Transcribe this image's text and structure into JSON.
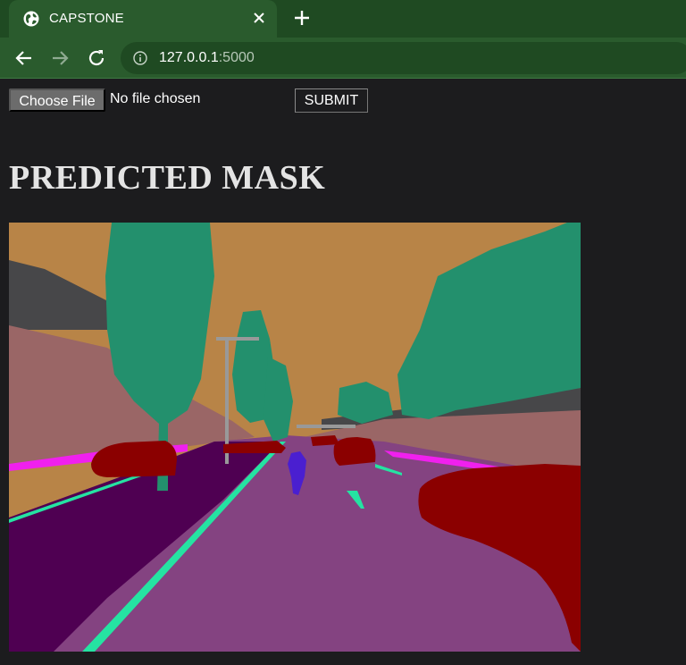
{
  "browser": {
    "tab_title": "CAPSTONE",
    "url_host": "127.0.0.1",
    "url_port": ":5000"
  },
  "form": {
    "file_button_label": "Choose File",
    "file_status": "No file chosen",
    "submit_label": "SUBMIT"
  },
  "page": {
    "heading": "PREDICTED MASK"
  },
  "mask_colors": {
    "sky": "#b88447",
    "vegetation": "#23906d",
    "building": "#474749",
    "wall": "#9a6666",
    "road": "#844381",
    "road_shadow": "#4f0052",
    "sidewalk": "#f020ee",
    "vehicle": "#8b0000",
    "lane_marking": "#25e3a2",
    "person": "#4a1fd0",
    "pole": "#999999"
  },
  "icons": {
    "favicon": "globe-icon",
    "close": "close-icon",
    "new_tab": "plus-icon",
    "back": "back-arrow-icon",
    "forward": "forward-arrow-icon",
    "reload": "reload-icon",
    "site_info": "info-icon"
  }
}
